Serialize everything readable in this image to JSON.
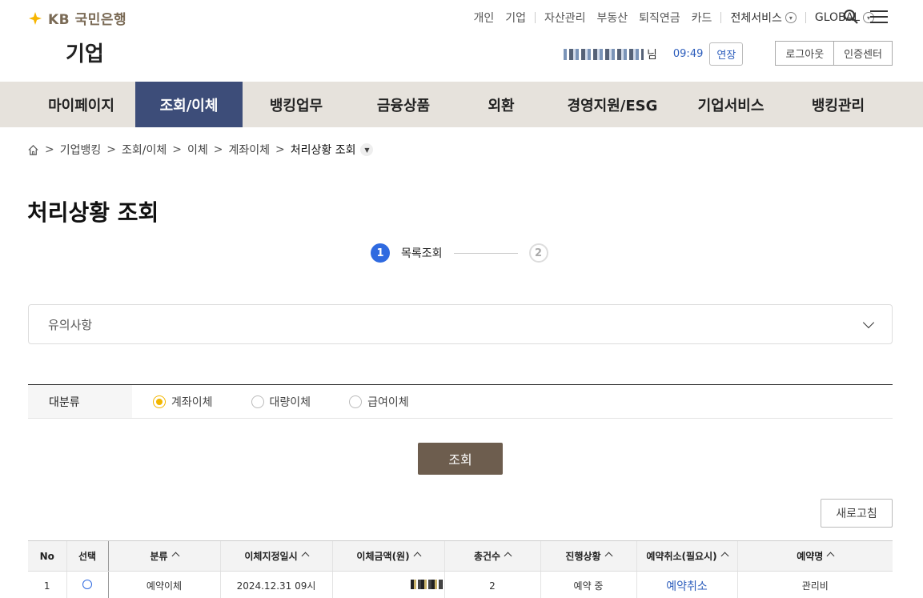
{
  "brand": {
    "logo_text": "KB",
    "logo_name": "국민은행",
    "section": "기업"
  },
  "top_nav": {
    "items": [
      "개인",
      "기업",
      "자산관리",
      "부동산",
      "퇴직연금",
      "카드"
    ],
    "all_services": "전체서비스",
    "global": "GLOBAL"
  },
  "user": {
    "suffix": "님",
    "time": "09:49",
    "extend": "연장",
    "logout": "로그아웃",
    "cert_center": "인증센터"
  },
  "gnb": [
    {
      "label": "마이페이지",
      "active": false
    },
    {
      "label": "조회/이체",
      "active": true
    },
    {
      "label": "뱅킹업무",
      "active": false
    },
    {
      "label": "금융상품",
      "active": false
    },
    {
      "label": "외환",
      "active": false
    },
    {
      "label": "경영지원/ESG",
      "active": false
    },
    {
      "label": "기업서비스",
      "active": false
    },
    {
      "label": "뱅킹관리",
      "active": false
    }
  ],
  "breadcrumb": [
    "기업뱅킹",
    "조회/이체",
    "이체",
    "계좌이체",
    "처리상황 조회"
  ],
  "page_title": "처리상황 조회",
  "steps": [
    {
      "num": "1",
      "label": "목록조회",
      "active": true
    },
    {
      "num": "2",
      "label": "",
      "active": false
    }
  ],
  "notice": {
    "title": "유의사항"
  },
  "filter": {
    "label": "대분류",
    "options": [
      {
        "label": "계좌이체",
        "checked": true
      },
      {
        "label": "대량이체",
        "checked": false
      },
      {
        "label": "급여이체",
        "checked": false
      }
    ]
  },
  "search_button": "조회",
  "refresh_button": "새로고침",
  "table": {
    "headers": [
      "No",
      "선택",
      "분류",
      "이체지정일시",
      "이체금액(원)",
      "총건수",
      "진행상황",
      "예약취소(필요시)",
      "예약명"
    ],
    "rows": [
      {
        "no": "1",
        "category": "예약이체",
        "datetime": "2024.12.31 09시",
        "count": "2",
        "status": "예약 중",
        "cancel": "예약취소",
        "name": "관리비"
      }
    ]
  },
  "colors": {
    "accent": "#3d4d79",
    "brand_yellow": "#f7b500",
    "button_brown": "#6d5d4e",
    "link_blue": "#2c5dbc"
  }
}
